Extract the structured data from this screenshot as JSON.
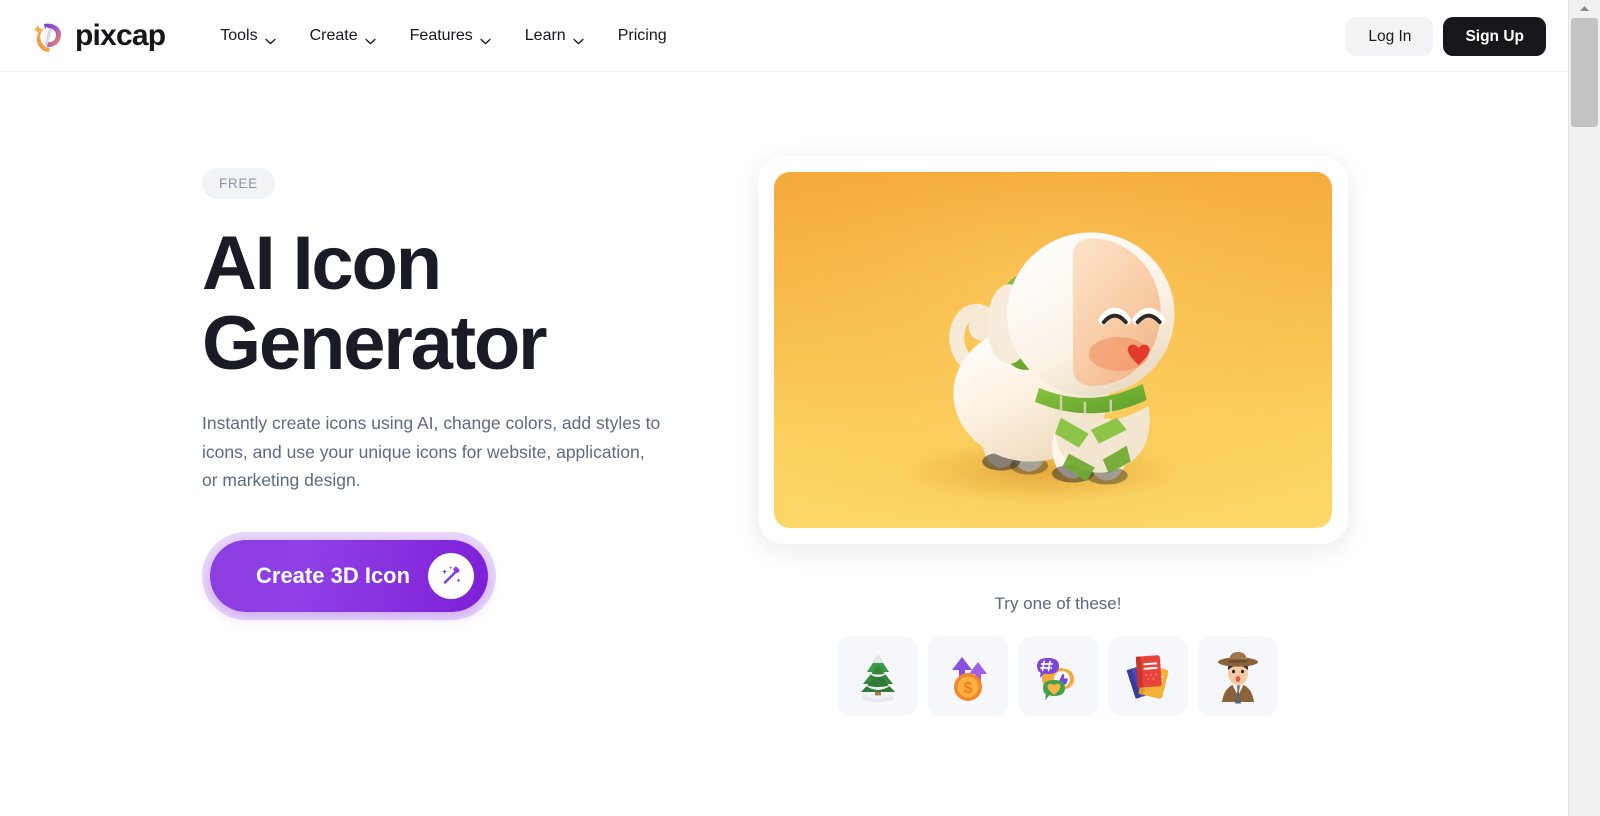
{
  "header": {
    "brand": {
      "name": "pixcap",
      "logo_icon": "pixcap-balloon-logo"
    },
    "nav": [
      {
        "label": "Tools",
        "has_dropdown": true
      },
      {
        "label": "Create",
        "has_dropdown": true
      },
      {
        "label": "Features",
        "has_dropdown": true
      },
      {
        "label": "Learn",
        "has_dropdown": true
      },
      {
        "label": "Pricing",
        "has_dropdown": false
      }
    ],
    "login_label": "Log In",
    "signup_label": "Sign Up"
  },
  "hero": {
    "badge": "FREE",
    "title_line1": "AI Icon",
    "title_line2": "Generator",
    "subtitle": "Instantly create icons using AI, change colors, add styles to icons, and use your unique icons for website, application, or marketing design.",
    "cta_label": "Create 3D Icon",
    "cta_icon": "magic-wand-icon",
    "preview_alt": "3d-dog-character-illustration",
    "try_label": "Try one of these!",
    "thumbnails": [
      {
        "name": "snowy-pine-tree-icon"
      },
      {
        "name": "coin-growth-arrows-icon"
      },
      {
        "name": "social-chat-bubbles-icon"
      },
      {
        "name": "stacked-books-icon"
      },
      {
        "name": "detective-character-icon"
      }
    ]
  },
  "colors": {
    "brand_dark": "#16161b",
    "cta_purple": "#8b3ee0",
    "cta_halo": "#e9d9fb",
    "text_muted": "#5e6a82",
    "badge_bg": "#f2f3f5",
    "card_bg": "#f6f7fa",
    "image_gradient_top": "#f5a93a",
    "image_gradient_bottom": "#fbd869"
  },
  "scrollbar": {
    "up_arrow_icon": "triangle-up-icon",
    "position_label": "top"
  }
}
